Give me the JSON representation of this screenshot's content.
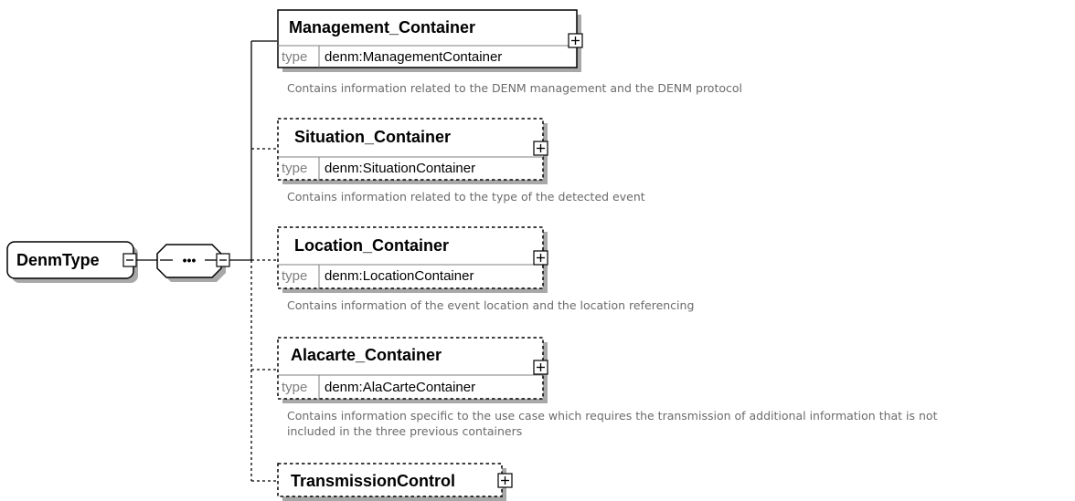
{
  "root": {
    "label": "DenmType"
  },
  "sequence": {
    "symbol": "•••"
  },
  "elements": [
    {
      "name": "Management_Container",
      "type_key": "type",
      "type_value": "denm:ManagementContainer",
      "optional": false,
      "description": [
        "Contains information related to the DENM management and the DENM protocol"
      ]
    },
    {
      "name": "Situation_Container",
      "type_key": "type",
      "type_value": "denm:SituationContainer",
      "optional": true,
      "description": [
        "Contains information related to the type of the detected event"
      ]
    },
    {
      "name": "Location_Container",
      "type_key": "type",
      "type_value": "denm:LocationContainer",
      "optional": true,
      "description": [
        "Contains information of the event location and the location referencing"
      ]
    },
    {
      "name": "Alacarte_Container",
      "type_key": "type",
      "type_value": "denm:AlaCarteContainer",
      "optional": true,
      "description": [
        "Contains information specific to the use case which requires the transmission of additional information that is not",
        "included in the three previous containers"
      ]
    },
    {
      "name": "TransmissionControl",
      "optional": true
    }
  ]
}
